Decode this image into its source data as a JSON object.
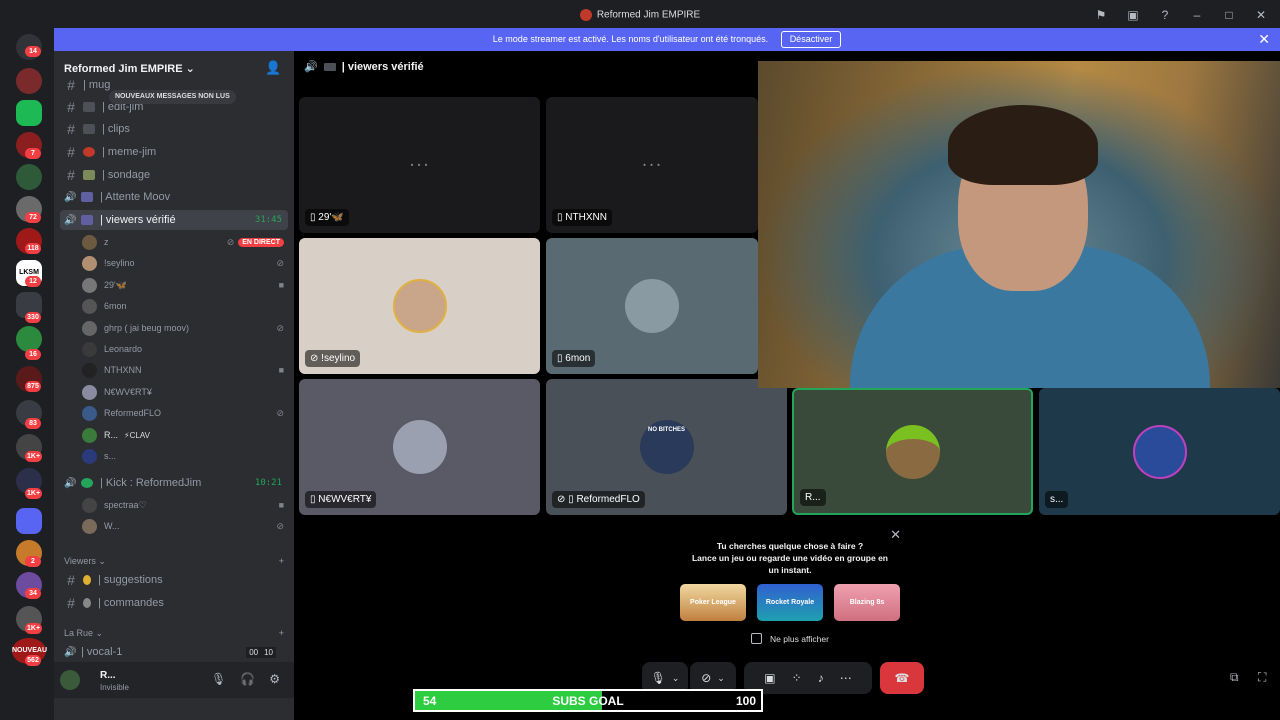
{
  "window": {
    "title": "Reformed Jim EMPIRE"
  },
  "banner": {
    "text": "Le mode streamer est activé. Les noms d'utilisateur ont été tronqués.",
    "button": "Désactiver"
  },
  "rail": {
    "badges": [
      "14",
      "7",
      "72",
      "118",
      "12",
      "330",
      "16",
      "875",
      "83",
      "1K+",
      "1K+",
      "2",
      "34",
      "1K+",
      "562"
    ],
    "icon_texts": [
      "LKSM",
      "NOUVEAU"
    ]
  },
  "sidebar": {
    "server_name": "Reformed Jim EMPIRE",
    "unread_pill": "NOUVEAUX MESSAGES NON LUS",
    "partial_channels": [
      "| mug",
      "| edit-jim"
    ],
    "channels": [
      {
        "label": "| clips",
        "type": "text"
      },
      {
        "label": "| meme-jim",
        "type": "text"
      },
      {
        "label": "| sondage",
        "type": "text"
      },
      {
        "label": "| Attente Moov",
        "type": "voice"
      },
      {
        "label": "| viewers vérifié",
        "type": "voice",
        "timer": "31:45"
      }
    ],
    "voice_users": [
      {
        "name": "z",
        "live": "EN DIRECT"
      },
      {
        "name": "!seylino"
      },
      {
        "name": "29'🦋"
      },
      {
        "name": "6mon"
      },
      {
        "name": "ghrp ( jai beug moov)"
      },
      {
        "name": "Leonardo"
      },
      {
        "name": "NTHXNN"
      },
      {
        "name": "N€WV€RT¥"
      },
      {
        "name": "ReformedFLO"
      },
      {
        "name": "R...",
        "tag": "⚡CLAV"
      },
      {
        "name": "s..."
      }
    ],
    "kick_channel": {
      "label": "| Kick : ReformedJim",
      "timer": "10:21"
    },
    "kick_users": [
      {
        "name": "spectraa♡"
      },
      {
        "name": "W..."
      }
    ],
    "category_viewers": "Viewers",
    "viewer_channels": [
      "| suggestions",
      "| commandes"
    ],
    "category_rue": "La Rue",
    "vocal": {
      "label": "| vocal-1",
      "count_a": "00",
      "count_b": "10"
    }
  },
  "user_panel": {
    "name": "R...",
    "status": "Invisible"
  },
  "main": {
    "header": "| viewers vérifié",
    "tiles": [
      {
        "name": "29'🦋"
      },
      {
        "name": "NTHXNN"
      },
      {
        "name": "!seylino"
      },
      {
        "name": "6mon"
      },
      {
        "name": "N€WV€RT¥"
      },
      {
        "name": "ReformedFLO",
        "avatar_text": "NO BITCHES"
      },
      {
        "name": "R..."
      },
      {
        "name": "s..."
      }
    ]
  },
  "popup": {
    "title_1": "Tu cherches quelque chose à faire ?",
    "title_2": "Lance un jeu ou regarde une vidéo en groupe en",
    "title_3": "un instant.",
    "games": [
      "Poker League",
      "Rocket Royale",
      "Blazing 8s"
    ],
    "checkbox": "Ne plus afficher"
  },
  "subs_goal": {
    "current": "54",
    "label": "SUBS GOAL",
    "target": "100",
    "progress": 0.54
  },
  "colors": {
    "accent": "#5865f2",
    "live": "#f23f43",
    "hangup": "#da373c",
    "voice_green": "#23a55a",
    "goal_fill": "#2ecc40"
  }
}
